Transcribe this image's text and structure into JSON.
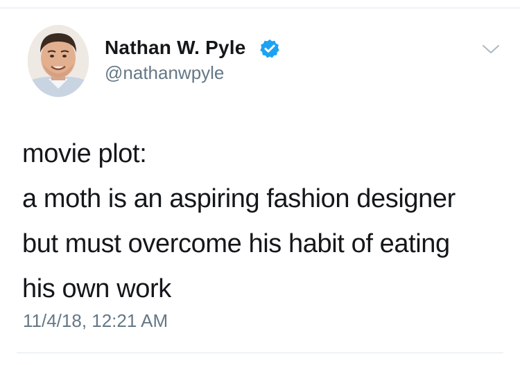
{
  "author": {
    "display_name": "Nathan W. Pyle",
    "handle": "@nathanwpyle",
    "verified": true,
    "avatar_icon": "profile-photo"
  },
  "tweet": {
    "lines": [
      "movie plot:",
      "a moth is an aspiring fashion designer",
      "but must overcome his habit of eating",
      "his own work"
    ],
    "timestamp": "11/4/18, 12:21 AM"
  },
  "icons": {
    "verified": "verified-badge-icon",
    "menu": "chevron-down-icon"
  },
  "colors": {
    "verified_blue": "#1da1f2",
    "text": "#14171a",
    "secondary_text": "#657786",
    "divider": "#e1e8ed"
  }
}
